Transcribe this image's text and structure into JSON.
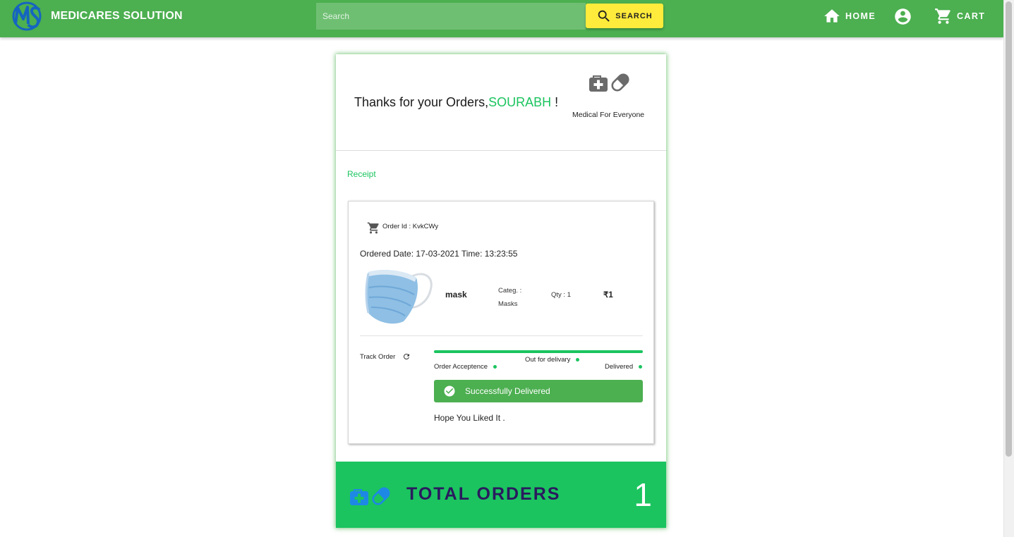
{
  "app": {
    "brand": "MEDICARES SOLUTION",
    "search_placeholder": "Search",
    "search_label": "SEARCH",
    "nav": {
      "home": "HOME",
      "cart": "CART"
    }
  },
  "header": {
    "thanks_prefix": "Thanks for your Orders,",
    "user_name": "SOURABH",
    "thanks_suffix": " !",
    "tagline": "Medical For Everyone"
  },
  "receipt": {
    "title": "Receipt",
    "order_id_text": "Order Id : KvkCWy",
    "ordered_date_text": "Ordered Date: 17-03-2021 Time: 13:23:55",
    "item": {
      "name": "mask",
      "category_text": "Categ. : Masks",
      "qty_text": "Qty : 1",
      "price": "₹1"
    },
    "tracking": {
      "label": "Track Order",
      "progress": 1.0,
      "steps": [
        "Order Acceptence",
        "Out for delivary",
        "Delivered"
      ],
      "status": "Successfully Delivered",
      "note": "Hope You Liked It ."
    }
  },
  "summary": {
    "label": "TOTAL ORDERS",
    "count": "1"
  },
  "colors": {
    "appbar": "#4caf50",
    "search_button": "#ffeb3b",
    "accent_green": "#1bc45f",
    "total_label": "#2a1a5e",
    "total_icons": "#1e88e5"
  },
  "icons": [
    "logo-ms",
    "search-icon",
    "home-icon",
    "account-circle-icon",
    "cart-icon",
    "medkit-icon",
    "pill-icon",
    "refresh-icon",
    "check-circle-icon"
  ]
}
